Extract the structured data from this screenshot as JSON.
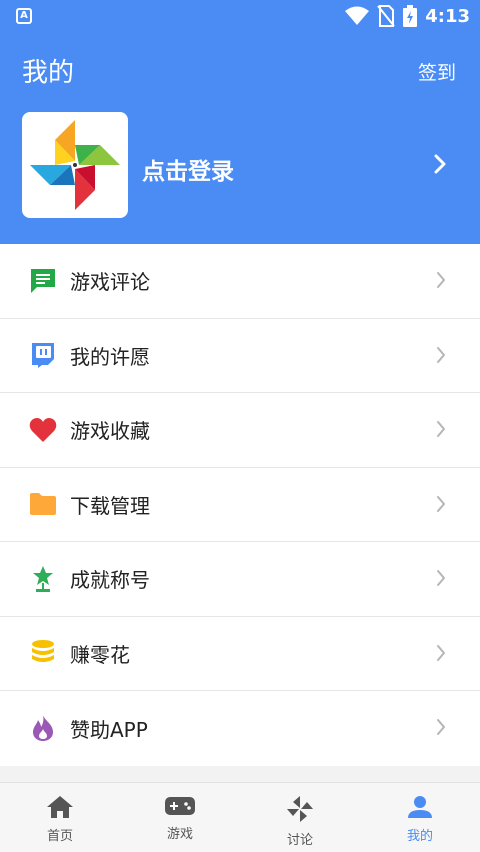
{
  "status_bar": {
    "time": "4:13",
    "app_badge": "A"
  },
  "header": {
    "title": "我的",
    "checkin_label": "签到",
    "login_label": "点击登录"
  },
  "menu": [
    {
      "id": "reviews",
      "label": "游戏评论",
      "icon": "comment-icon",
      "color": "#22a846"
    },
    {
      "id": "wishes",
      "label": "我的许愿",
      "icon": "wish-bubble-icon",
      "color": "#4a8cf4"
    },
    {
      "id": "favorites",
      "label": "游戏收藏",
      "icon": "heart-icon",
      "color": "#e3323c"
    },
    {
      "id": "downloads",
      "label": "下载管理",
      "icon": "folder-icon",
      "color": "#ffa83a"
    },
    {
      "id": "achievements",
      "label": "成就称号",
      "icon": "trophy-star-icon",
      "color": "#2fae5a"
    },
    {
      "id": "earn",
      "label": "赚零花",
      "icon": "coins-icon",
      "color": "#f7c000"
    },
    {
      "id": "sponsor",
      "label": "赞助APP",
      "icon": "flame-icon",
      "color": "#9b59b6"
    }
  ],
  "tabs": [
    {
      "id": "home",
      "label": "首页",
      "icon": "home-icon",
      "active": false
    },
    {
      "id": "games",
      "label": "游戏",
      "icon": "gamepad-icon",
      "active": false
    },
    {
      "id": "discuss",
      "label": "讨论",
      "icon": "pinwheel-icon",
      "active": false
    },
    {
      "id": "mine",
      "label": "我的",
      "icon": "person-icon",
      "active": true
    }
  ],
  "colors": {
    "primary": "#4a8cf4",
    "tab_inactive": "#555555"
  }
}
